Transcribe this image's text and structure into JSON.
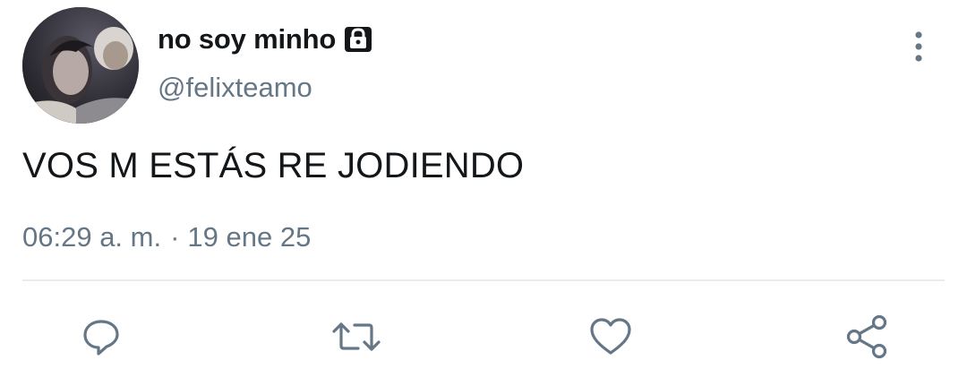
{
  "user": {
    "display_name": "no soy minho",
    "handle": "@felixteamo",
    "protected_icon": "lock-icon",
    "avatar": "profile-photo"
  },
  "tweet": {
    "text": "VOS M ESTÁS RE JODIENDO",
    "time": "06:29 a. m.",
    "separator": "·",
    "date": "19 ene 25"
  },
  "actions": [
    {
      "icon": "reply-icon"
    },
    {
      "icon": "retweet-icon"
    },
    {
      "icon": "like-icon"
    },
    {
      "icon": "share-icon"
    }
  ],
  "menu_icon": "more-vertical-icon",
  "colors": {
    "text_primary": "#14171a",
    "text_secondary": "#657786",
    "divider": "#e6ecf0",
    "background": "#ffffff"
  }
}
